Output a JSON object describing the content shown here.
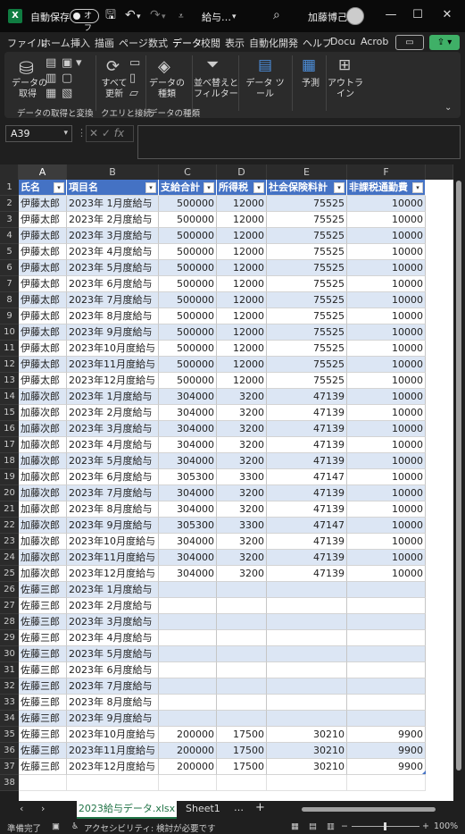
{
  "titlebar": {
    "app_icon": "X",
    "autosave_label": "自動保存",
    "autosave_state": "オフ",
    "doc_title": "給与…",
    "user_name": "加藤博己"
  },
  "tabs": [
    "ファイル",
    "ホーム",
    "挿入",
    "描画",
    "ページ",
    "数式",
    "データ",
    "校閲",
    "表示",
    "自動化",
    "開発",
    "ヘルプ",
    "Docu",
    "Acrob"
  ],
  "active_tab": "データ",
  "ribbon": {
    "get_data_label": "データの\n取得",
    "get_transform_group": "データの取得と変換",
    "refresh_all_label": "すべて\n更新",
    "queries_group": "クエリと接続",
    "data_types_label": "データの\n種類",
    "data_types_group": "データの種類",
    "sort_filter_label": "並べ替えと\nフィルター",
    "data_tools_label": "データ ツール",
    "forecast_label": "予測",
    "outline_label": "アウトラ\nイン"
  },
  "formula_bar": {
    "name_box": "A39",
    "fx": "fx",
    "formula": ""
  },
  "columns": [
    "A",
    "B",
    "C",
    "D",
    "E",
    "F"
  ],
  "selected_column": "A",
  "table": {
    "headers": [
      "氏名",
      "項目名",
      "支給合計",
      "所得税",
      "社会保険料計",
      "非課税通勤費"
    ],
    "rows": [
      [
        "伊藤太郎",
        "2023年 1月度給与",
        "500000",
        "12000",
        "75525",
        "10000"
      ],
      [
        "伊藤太郎",
        "2023年 2月度給与",
        "500000",
        "12000",
        "75525",
        "10000"
      ],
      [
        "伊藤太郎",
        "2023年 3月度給与",
        "500000",
        "12000",
        "75525",
        "10000"
      ],
      [
        "伊藤太郎",
        "2023年 4月度給与",
        "500000",
        "12000",
        "75525",
        "10000"
      ],
      [
        "伊藤太郎",
        "2023年 5月度給与",
        "500000",
        "12000",
        "75525",
        "10000"
      ],
      [
        "伊藤太郎",
        "2023年 6月度給与",
        "500000",
        "12000",
        "75525",
        "10000"
      ],
      [
        "伊藤太郎",
        "2023年 7月度給与",
        "500000",
        "12000",
        "75525",
        "10000"
      ],
      [
        "伊藤太郎",
        "2023年 8月度給与",
        "500000",
        "12000",
        "75525",
        "10000"
      ],
      [
        "伊藤太郎",
        "2023年 9月度給与",
        "500000",
        "12000",
        "75525",
        "10000"
      ],
      [
        "伊藤太郎",
        "2023年10月度給与",
        "500000",
        "12000",
        "75525",
        "10000"
      ],
      [
        "伊藤太郎",
        "2023年11月度給与",
        "500000",
        "12000",
        "75525",
        "10000"
      ],
      [
        "伊藤太郎",
        "2023年12月度給与",
        "500000",
        "12000",
        "75525",
        "10000"
      ],
      [
        "加藤次郎",
        "2023年 1月度給与",
        "304000",
        "3200",
        "47139",
        "10000"
      ],
      [
        "加藤次郎",
        "2023年 2月度給与",
        "304000",
        "3200",
        "47139",
        "10000"
      ],
      [
        "加藤次郎",
        "2023年 3月度給与",
        "304000",
        "3200",
        "47139",
        "10000"
      ],
      [
        "加藤次郎",
        "2023年 4月度給与",
        "304000",
        "3200",
        "47139",
        "10000"
      ],
      [
        "加藤次郎",
        "2023年 5月度給与",
        "304000",
        "3200",
        "47139",
        "10000"
      ],
      [
        "加藤次郎",
        "2023年 6月度給与",
        "305300",
        "3300",
        "47147",
        "10000"
      ],
      [
        "加藤次郎",
        "2023年 7月度給与",
        "304000",
        "3200",
        "47139",
        "10000"
      ],
      [
        "加藤次郎",
        "2023年 8月度給与",
        "304000",
        "3200",
        "47139",
        "10000"
      ],
      [
        "加藤次郎",
        "2023年 9月度給与",
        "305300",
        "3300",
        "47147",
        "10000"
      ],
      [
        "加藤次郎",
        "2023年10月度給与",
        "304000",
        "3200",
        "47139",
        "10000"
      ],
      [
        "加藤次郎",
        "2023年11月度給与",
        "304000",
        "3200",
        "47139",
        "10000"
      ],
      [
        "加藤次郎",
        "2023年12月度給与",
        "304000",
        "3200",
        "47139",
        "10000"
      ],
      [
        "佐藤三郎",
        "2023年 1月度給与",
        "",
        "",
        "",
        ""
      ],
      [
        "佐藤三郎",
        "2023年 2月度給与",
        "",
        "",
        "",
        ""
      ],
      [
        "佐藤三郎",
        "2023年 3月度給与",
        "",
        "",
        "",
        ""
      ],
      [
        "佐藤三郎",
        "2023年 4月度給与",
        "",
        "",
        "",
        ""
      ],
      [
        "佐藤三郎",
        "2023年 5月度給与",
        "",
        "",
        "",
        ""
      ],
      [
        "佐藤三郎",
        "2023年 6月度給与",
        "",
        "",
        "",
        ""
      ],
      [
        "佐藤三郎",
        "2023年 7月度給与",
        "",
        "",
        "",
        ""
      ],
      [
        "佐藤三郎",
        "2023年 8月度給与",
        "",
        "",
        "",
        ""
      ],
      [
        "佐藤三郎",
        "2023年 9月度給与",
        "",
        "",
        "",
        ""
      ],
      [
        "佐藤三郎",
        "2023年10月度給与",
        "200000",
        "17500",
        "30210",
        "9900"
      ],
      [
        "佐藤三郎",
        "2023年11月度給与",
        "200000",
        "17500",
        "30210",
        "9900"
      ],
      [
        "佐藤三郎",
        "2023年12月度給与",
        "200000",
        "17500",
        "30210",
        "9900"
      ]
    ]
  },
  "row_numbers": [
    "1",
    "2",
    "3",
    "4",
    "5",
    "6",
    "7",
    "8",
    "9",
    "10",
    "11",
    "12",
    "13",
    "14",
    "15",
    "16",
    "17",
    "18",
    "19",
    "20",
    "21",
    "22",
    "23",
    "24",
    "25",
    "26",
    "27",
    "28",
    "29",
    "30",
    "31",
    "32",
    "33",
    "34",
    "35",
    "36",
    "37",
    "38"
  ],
  "sheet_tabs": {
    "active": "2023給与データ.xlsx",
    "other": "Sheet1",
    "more": "…",
    "add": "+"
  },
  "status": {
    "ready": "準備完了",
    "accessibility": "アクセシビリティ: 検討が必要です",
    "zoom": "100%"
  },
  "colors": {
    "header_blue": "#4472c4",
    "band_blue": "#dce6f4",
    "accent_green": "#3fb067"
  }
}
